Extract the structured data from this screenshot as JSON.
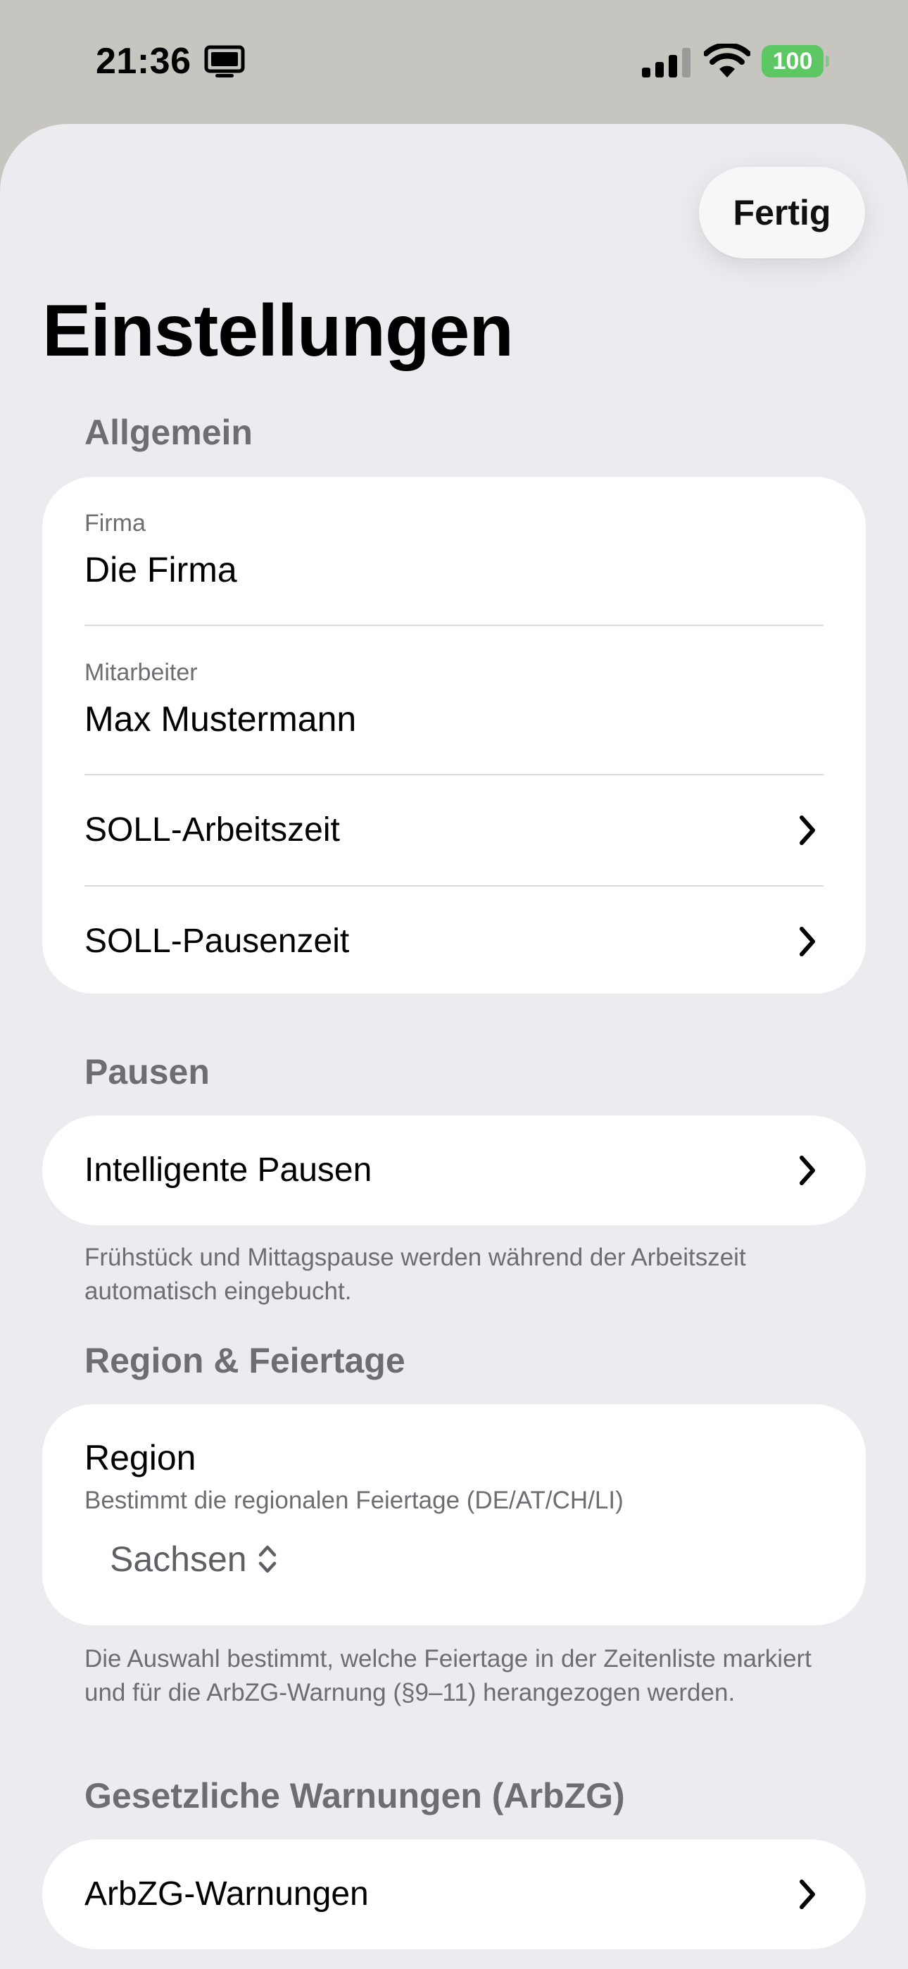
{
  "status_bar": {
    "time": "21:36",
    "battery": "100"
  },
  "sheet": {
    "done_label": "Fertig",
    "title": "Einstellungen"
  },
  "sections": {
    "general": {
      "header": "Allgemein",
      "company_label": "Firma",
      "company_value": "Die Firma",
      "employee_label": "Mitarbeiter",
      "employee_value": "Max Mustermann",
      "target_work_time": "SOLL-Arbeitszeit",
      "target_break_time": "SOLL-Pausenzeit"
    },
    "breaks": {
      "header": "Pausen",
      "smart_breaks": "Intelligente Pausen",
      "footnote": "Frühstück und Mittagspause werden während der Arbeitszeit automatisch eingebucht."
    },
    "region": {
      "header": "Region & Feiertage",
      "title": "Region",
      "description": "Bestimmt die regionalen Feiertage (DE/AT/CH/LI)",
      "selected": "Sachsen",
      "footnote": "Die Auswahl bestimmt, welche Feiertage in der Zeitenliste markiert und für die ArbZG-Warnung (§9–11) herangezogen werden."
    },
    "warnings": {
      "header": "Gesetzliche Warnungen (ArbZG)",
      "arbzg_warnings": "ArbZG-Warnungen"
    }
  },
  "icons": {
    "screen": "tv-icon",
    "signal": "cellular-signal-icon",
    "wifi": "wifi-icon",
    "chevron": "chevron-right-icon",
    "picker": "chevron-up-down-icon"
  },
  "colors": {
    "sheet_background": "#ebebf0",
    "battery": "#5cc763",
    "secondary_text": "#6d6d72"
  }
}
